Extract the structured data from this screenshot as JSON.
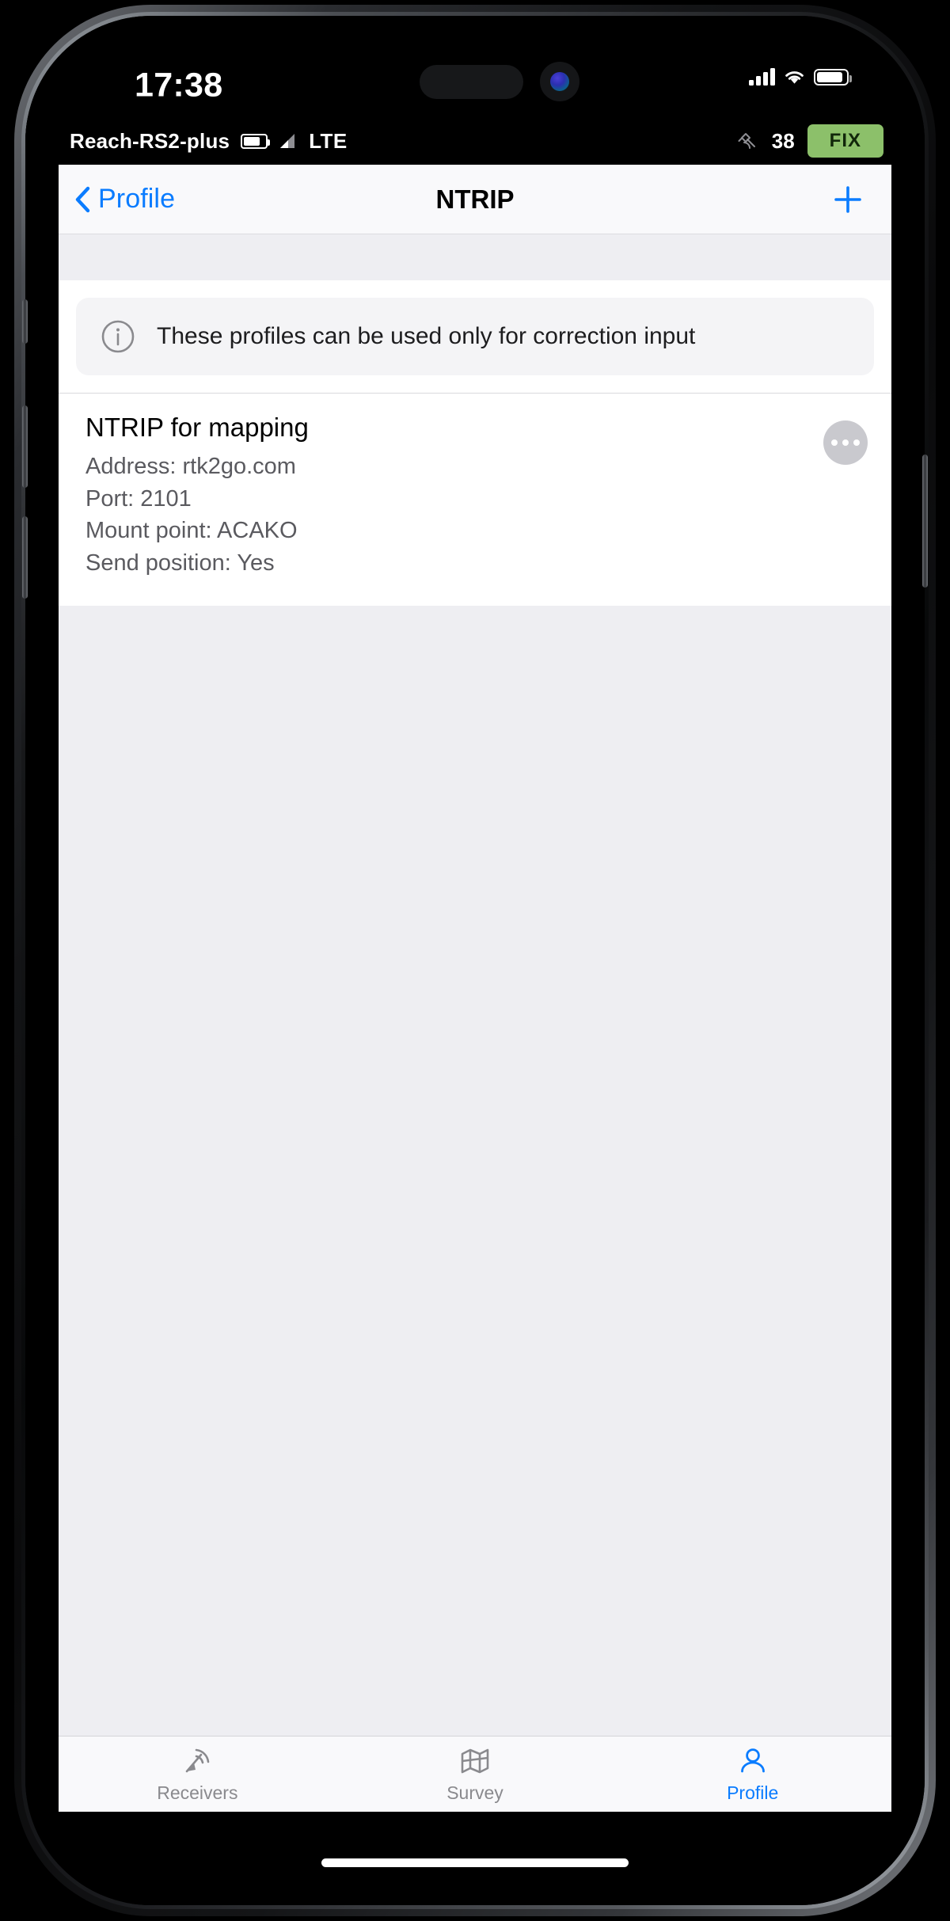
{
  "ios_status": {
    "time": "17:38",
    "cellular_icon": "cellular-bars-icon",
    "wifi_icon": "wifi-icon",
    "battery_icon": "battery-icon"
  },
  "device_bar": {
    "device_name": "Reach-RS2-plus",
    "battery_icon": "device-battery-icon",
    "signal_icon": "cellular-signal-icon",
    "network": "LTE",
    "satellite_icon": "satellite-icon",
    "satellite_count": "38",
    "fix_status": "FIX",
    "fix_color": "#8cc06a"
  },
  "navbar": {
    "back_label": "Profile",
    "back_icon": "chevron-left-icon",
    "title": "NTRIP",
    "add_icon": "plus-icon",
    "accent_color": "#0a7cff"
  },
  "info_banner": {
    "icon": "info-circle-icon",
    "text": "These profiles can be used only for correction input"
  },
  "profiles": [
    {
      "name": "NTRIP for mapping",
      "address_line": "Address: rtk2go.com",
      "port_line": "Port: 2101",
      "mount_point_line": "Mount point: ACAKO",
      "send_position_line": "Send position: Yes",
      "more_icon": "more-ellipsis-icon"
    }
  ],
  "tabbar": {
    "tabs": [
      {
        "label": "Receivers",
        "icon": "receiver-antenna-icon",
        "active": false
      },
      {
        "label": "Survey",
        "icon": "survey-map-icon",
        "active": false
      },
      {
        "label": "Profile",
        "icon": "person-icon",
        "active": true
      }
    ]
  }
}
